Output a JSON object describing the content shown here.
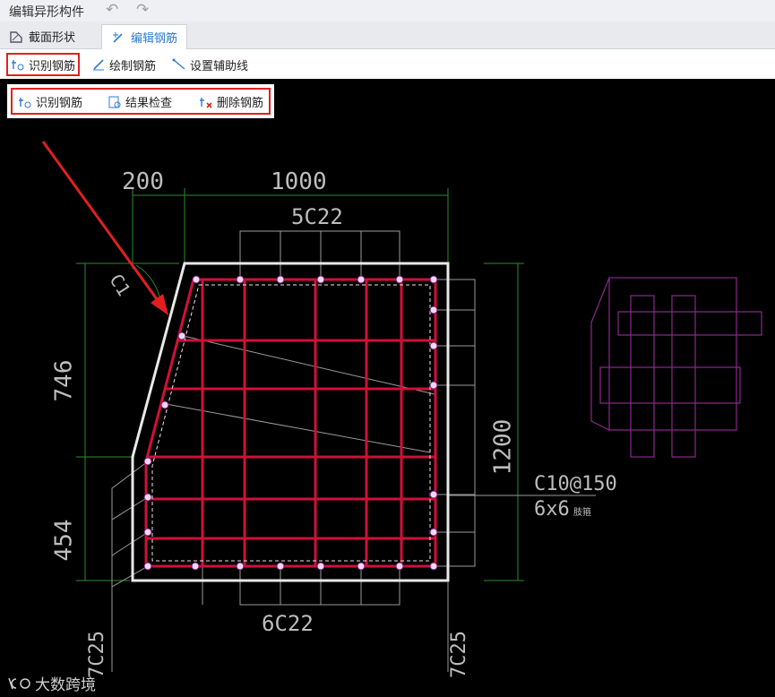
{
  "window": {
    "title": "编辑异形构件"
  },
  "tabs": [
    {
      "label": "截面形状"
    },
    {
      "label": "编辑钢筋"
    }
  ],
  "toolbar": {
    "identify": "识别钢筋",
    "draw": "绘制钢筋",
    "aux": "设置辅助线"
  },
  "popup": {
    "identify": "识别钢筋",
    "check": "结果检查",
    "delete": "删除钢筋"
  },
  "drawing": {
    "dim_top_left": "200",
    "dim_top": "1000",
    "rebar_top": "5C22",
    "dim_left_upper": "746",
    "dim_left_lower": "454",
    "dim_right": "1200",
    "stirrup_spec": "C10@150",
    "stirrup_legs": "6x6",
    "stirrup_note": "肢箍",
    "rebar_bottom": "6C22",
    "rebar_left": "7C25",
    "rebar_right": "7C25",
    "corner_rebar": "C1"
  },
  "watermark": "大数跨境",
  "colors": {
    "highlight": "#e02020",
    "rebar": "#d0103a",
    "dim": "#2e8b2e",
    "aux": "#8a2a8a"
  }
}
